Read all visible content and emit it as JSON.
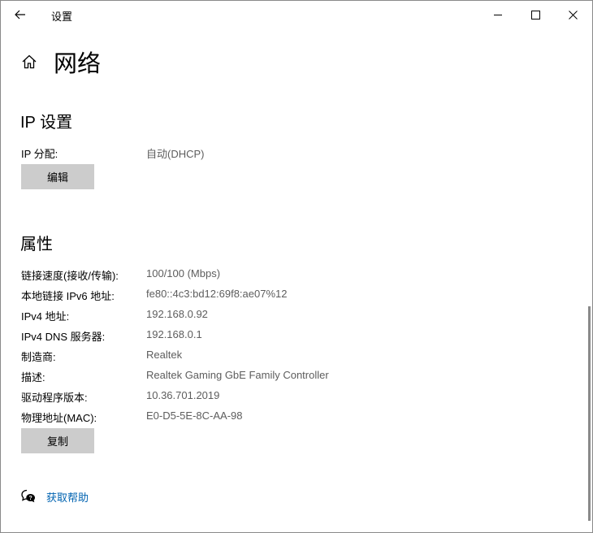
{
  "window": {
    "title": "设置",
    "back_icon": "back-arrow-icon",
    "minimize_icon": "minimize-icon",
    "maximize_icon": "maximize-icon",
    "close_icon": "close-icon"
  },
  "header": {
    "home_icon": "home-icon",
    "title": "网络"
  },
  "ip_settings": {
    "title": "IP 设置",
    "assignment_label": "IP 分配:",
    "assignment_value": "自动(DHCP)",
    "edit_button": "编辑"
  },
  "properties": {
    "title": "属性",
    "rows": [
      {
        "label": "链接速度(接收/传输):",
        "value": "100/100 (Mbps)"
      },
      {
        "label": "本地链接 IPv6 地址:",
        "value": "fe80::4c3:bd12:69f8:ae07%12"
      },
      {
        "label": "IPv4 地址:",
        "value": "192.168.0.92"
      },
      {
        "label": "IPv4 DNS 服务器:",
        "value": "192.168.0.1"
      },
      {
        "label": "制造商:",
        "value": "Realtek"
      },
      {
        "label": "描述:",
        "value": "Realtek Gaming GbE Family Controller"
      },
      {
        "label": "驱动程序版本:",
        "value": "10.36.701.2019"
      },
      {
        "label": "物理地址(MAC):",
        "value": "E0-D5-5E-8C-AA-98"
      }
    ],
    "copy_button": "复制"
  },
  "help": {
    "icon": "help-chat-icon",
    "link": "获取帮助"
  },
  "colors": {
    "link": "#0063b1",
    "button_bg": "#cccccc",
    "secondary_text": "#5d5d5d"
  }
}
